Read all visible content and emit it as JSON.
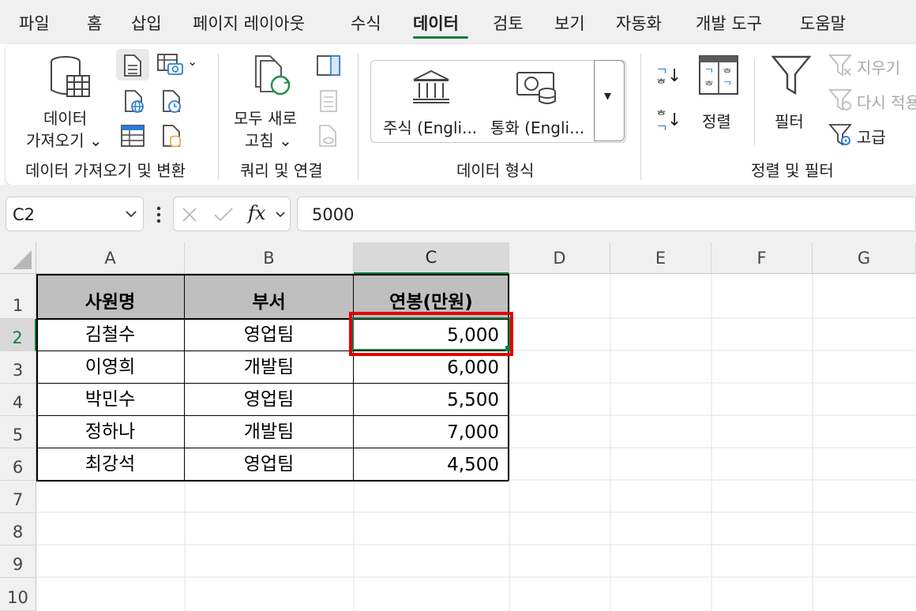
{
  "menu": {
    "tabs": [
      {
        "label": "파일"
      },
      {
        "label": "홈"
      },
      {
        "label": "삽입"
      },
      {
        "label": "페이지 레이아웃"
      },
      {
        "label": "수식"
      },
      {
        "label": "데이터"
      },
      {
        "label": "검토"
      },
      {
        "label": "보기"
      },
      {
        "label": "자동화"
      },
      {
        "label": "개발 도구"
      },
      {
        "label": "도움말"
      }
    ],
    "active": "데이터"
  },
  "ribbon": {
    "get_data": {
      "label_line1": "데이터",
      "label_line2": "가져오기 ⌄",
      "group_label": "데이터 가져오기 및 변환"
    },
    "queries": {
      "label_line1": "모두 새로",
      "label_line2": "고침 ⌄",
      "group_label": "쿼리 및 연결"
    },
    "data_types": {
      "stocks": "주식 (Engli...",
      "currency": "통화 (Engli...",
      "group_label": "데이터 형식"
    },
    "sort_filter": {
      "sort_label": "정렬",
      "filter_label": "필터",
      "clear_label": "지우기",
      "reapply_label": "다시 적용",
      "advanced_label": "고급",
      "sort_az_top": "ᄀ",
      "sort_az_bottom": "ᄒ",
      "group_label": "정렬 및 필터"
    }
  },
  "formula_bar": {
    "name_box": "C2",
    "fx": "fx",
    "value": "5000"
  },
  "sheet": {
    "columns": [
      "A",
      "B",
      "C",
      "D",
      "E",
      "F",
      "G"
    ],
    "rows": [
      "1",
      "2",
      "3",
      "4",
      "5",
      "6",
      "7",
      "8",
      "9",
      "10"
    ],
    "selected_cell": "C2",
    "table": {
      "headers": [
        "사원명",
        "부서",
        "연봉(만원)"
      ],
      "rows": [
        [
          "김철수",
          "영업팀",
          "5,000"
        ],
        [
          "이영희",
          "개발팀",
          "6,000"
        ],
        [
          "박민수",
          "영업팀",
          "5,500"
        ],
        [
          "정하나",
          "개발팀",
          "7,000"
        ],
        [
          "최강석",
          "영업팀",
          "4,500"
        ]
      ]
    }
  },
  "colors": {
    "accent": "#107c41",
    "highlight": "#e30000",
    "header_fill": "#bfbfbf"
  }
}
